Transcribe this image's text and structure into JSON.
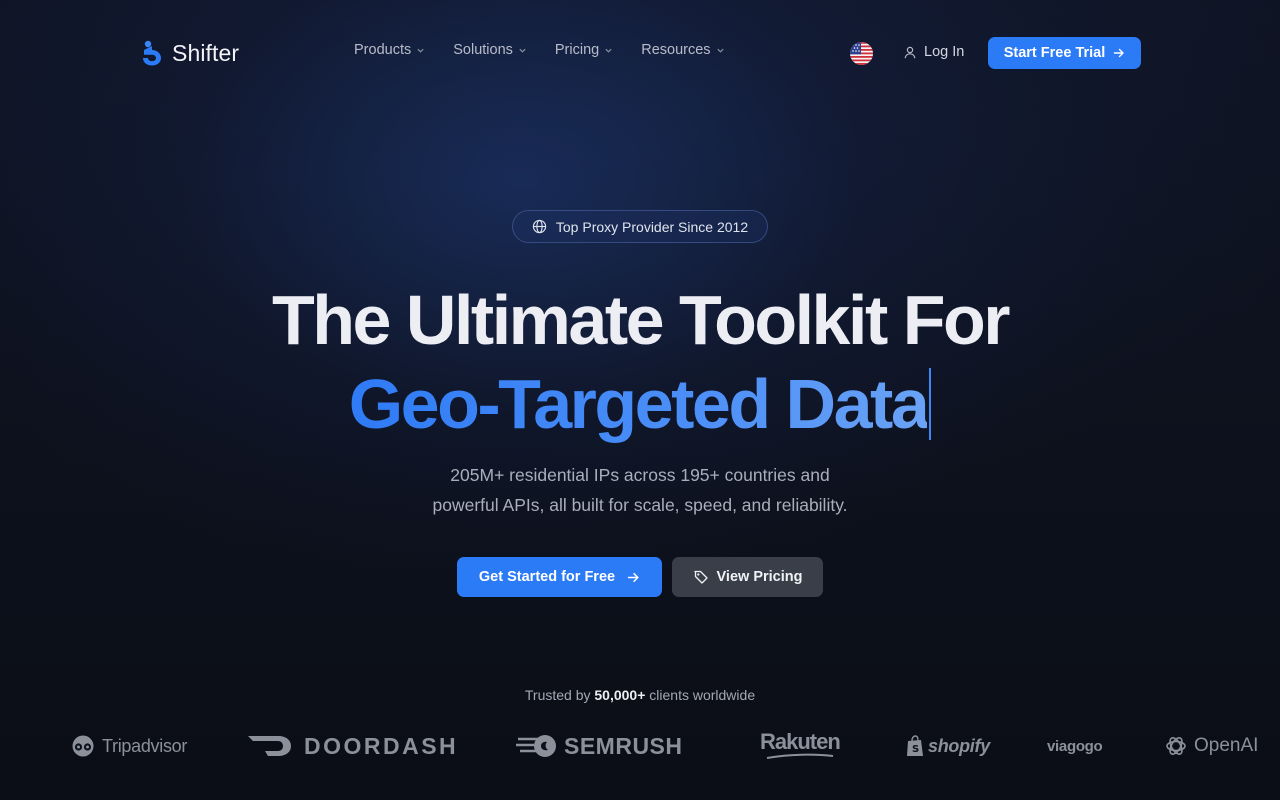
{
  "brand": {
    "name": "Shifter",
    "accent": "#2b7bf7"
  },
  "nav": {
    "items": [
      {
        "label": "Products"
      },
      {
        "label": "Solutions"
      },
      {
        "label": "Pricing"
      },
      {
        "label": "Resources"
      }
    ],
    "login_label": "Log In",
    "cta_label": "Start Free Trial"
  },
  "hero": {
    "badge": "Top Proxy Provider Since 2012",
    "title_line1": "The Ultimate Toolkit For",
    "title_line2": "Geo-Targeted Data",
    "subtitle_line1": "205M+ residential IPs across 195+ countries and",
    "subtitle_line2": "powerful APIs, all built for scale, speed, and reliability.",
    "primary_cta": "Get Started for Free",
    "secondary_cta": "View Pricing"
  },
  "trusted": {
    "prefix": "Trusted by",
    "count": "50,000+",
    "suffix": "clients worldwide",
    "clients": [
      "Tripadvisor",
      "DOORDASH",
      "SEMRUSH",
      "Rakuten",
      "shopify",
      "viagogo",
      "OpenAI"
    ]
  }
}
